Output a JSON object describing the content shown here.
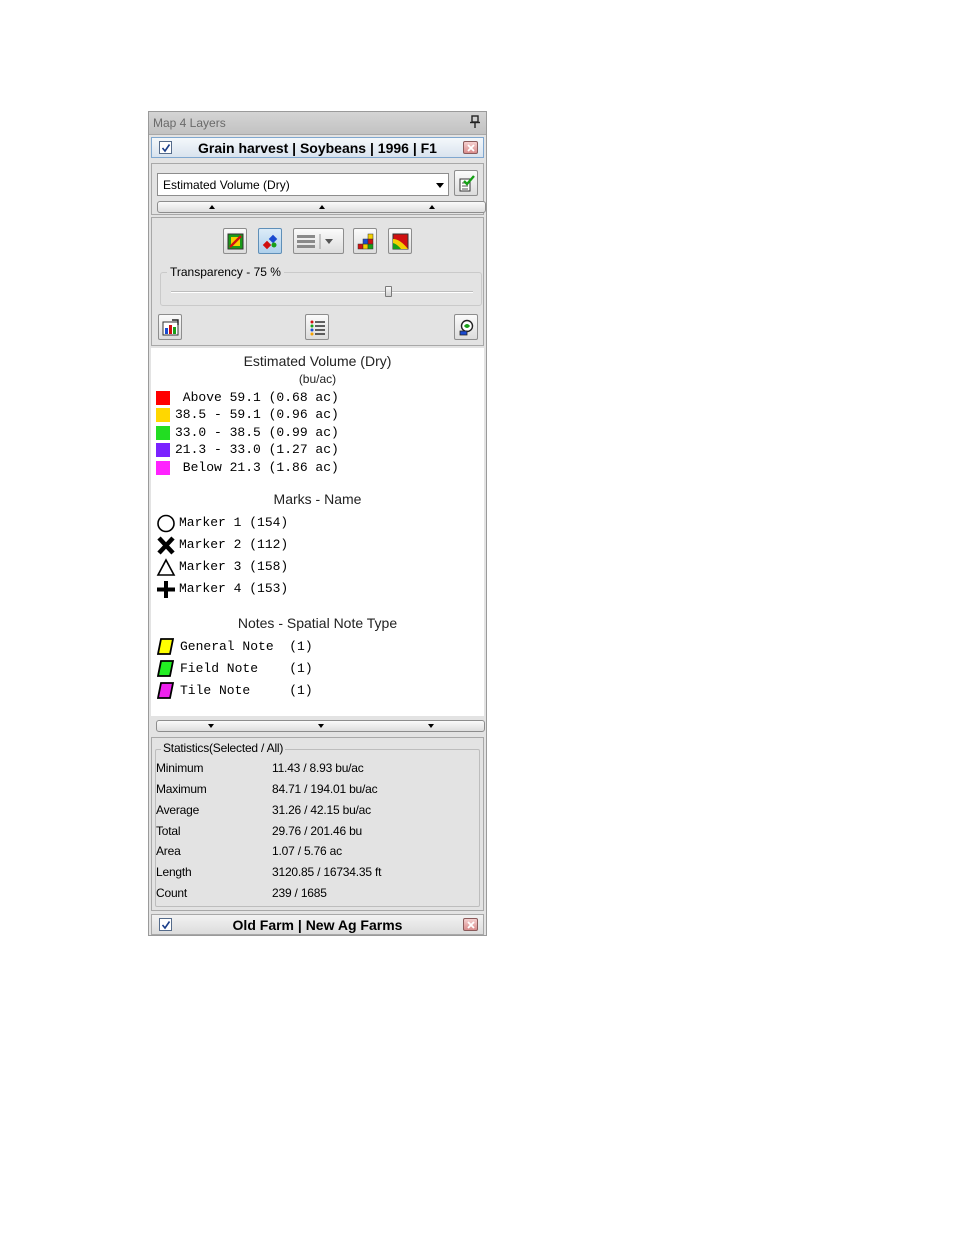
{
  "panel": {
    "title": "Map 4 Layers"
  },
  "layer1": {
    "title": "Grain harvest | Soybeans | 1996 | F1",
    "checked": true
  },
  "attribute": {
    "selected": "Estimated Volume (Dry)"
  },
  "transparency": {
    "label": "Transparency - 75 %",
    "value_percent": 75
  },
  "legend": {
    "title": "Estimated Volume (Dry)",
    "units": "(bu/ac)",
    "ranges": [
      {
        "label": " Above 59.1 (0.68 ac)",
        "color": "#ff0000"
      },
      {
        "label": "38.5 - 59.1 (0.96 ac)",
        "color": "#ffd700"
      },
      {
        "label": "33.0 - 38.5 (0.99 ac)",
        "color": "#22dd22"
      },
      {
        "label": "21.3 - 33.0 (1.27 ac)",
        "color": "#7a22ff"
      },
      {
        "label": " Below 21.3 (1.86 ac)",
        "color": "#ff22ff"
      }
    ],
    "marks_title": "Marks - Name",
    "marks": [
      {
        "label": "Marker 1 (154)",
        "icon": "circle-marker-icon"
      },
      {
        "label": "Marker 2 (112)",
        "icon": "x-marker-icon"
      },
      {
        "label": "Marker 3 (158)",
        "icon": "triangle-marker-icon"
      },
      {
        "label": "Marker 4 (153)",
        "icon": "plus-marker-icon"
      }
    ],
    "notes_title": "Notes - Spatial Note Type",
    "notes": [
      {
        "label": "General Note  (1)",
        "color": "#ffff00"
      },
      {
        "label": "Field Note    (1)",
        "color": "#22ee22"
      },
      {
        "label": "Tile Note     (1)",
        "color": "#ee22ee"
      }
    ]
  },
  "statistics": {
    "title": "Statistics(Selected / All)",
    "rows": [
      {
        "label": "Minimum",
        "value": "11.43 / 8.93 bu/ac"
      },
      {
        "label": "Maximum",
        "value": "84.71 / 194.01 bu/ac"
      },
      {
        "label": "Average",
        "value": "31.26 / 42.15 bu/ac"
      },
      {
        "label": "Total",
        "value": "29.76 / 201.46 bu"
      },
      {
        "label": "Area",
        "value": "1.07 / 5.76 ac"
      },
      {
        "label": "Length",
        "value": "3120.85 / 16734.35 ft"
      },
      {
        "label": "Count",
        "value": "239 / 1685"
      }
    ]
  },
  "layer2": {
    "title": "Old Farm | New Ag Farms",
    "checked": true
  }
}
